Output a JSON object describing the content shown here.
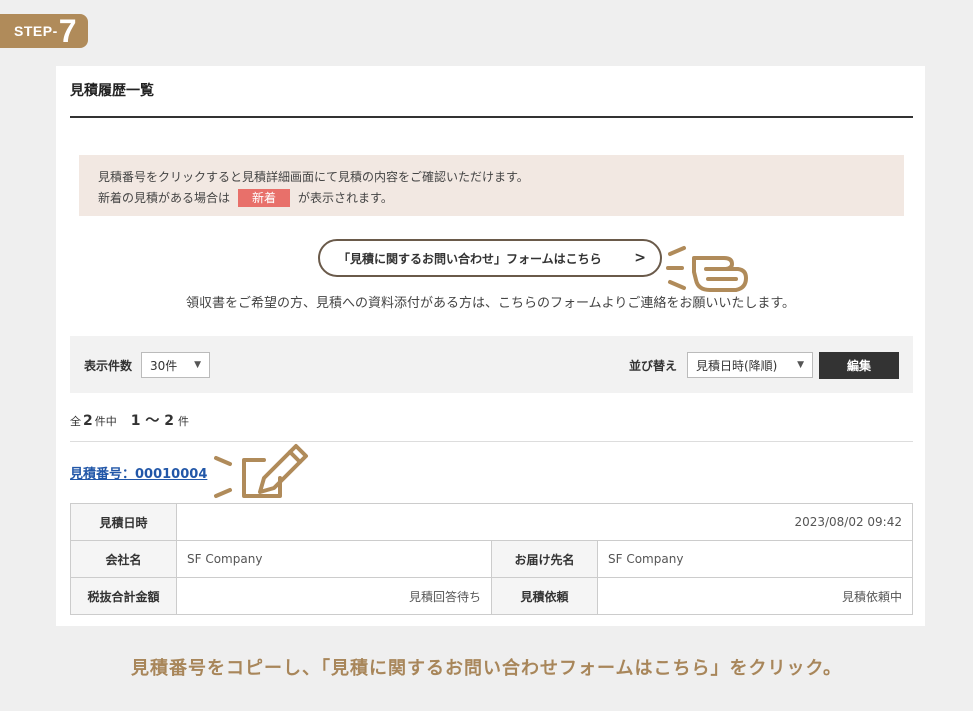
{
  "step": {
    "label": "STEP-",
    "number": "7"
  },
  "panel": {
    "title": "見積履歴一覧"
  },
  "notice": {
    "line1": "見積番号をクリックすると見積詳細画面にて見積の内容をご確認いただけます。",
    "line2_before": "新着の見積がある場合は",
    "badge": "新着",
    "line2_after": "が表示されます。"
  },
  "inquiry_button": {
    "label": "「見積に関するお問い合わせ」フォームはこちら",
    "chevron": ">"
  },
  "sub_note": "領収書をご希望の方、見積への資料添付がある方は、こちらのフォームよりご連絡をお願いいたします。",
  "controls": {
    "display_count_label": "表示件数",
    "display_count_value": "30件",
    "sort_label": "並び替え",
    "sort_value": "見積日時(降順)",
    "edit_label": "編集"
  },
  "count": {
    "prefix": "全",
    "total": "2",
    "mid": "件中",
    "range": "1 〜 2",
    "suffix": "件"
  },
  "estimate": {
    "link": "見積番号：00010004",
    "rows": {
      "date_label": "見積日時",
      "date_value": "2023/08/02 09:42",
      "company_label": "会社名",
      "company_value": "SF Company",
      "dest_label": "お届け先名",
      "dest_value": "SF Company",
      "amount_label": "税抜合計金額",
      "amount_value": "見積回答待ち",
      "request_label": "見積依頼",
      "request_value": "見積依頼中"
    }
  },
  "caption": "見積番号をコピーし、「見積に関するお問い合わせフォームはこちら」をクリック。",
  "colors": {
    "accent": "#b08b5a",
    "new_badge": "#e8706a",
    "link": "#2257a8",
    "dark_button": "#333333"
  },
  "icons": [
    "pointing-hand-icon",
    "pencil-icon",
    "chevron-right-icon",
    "caret-down-icon"
  ]
}
